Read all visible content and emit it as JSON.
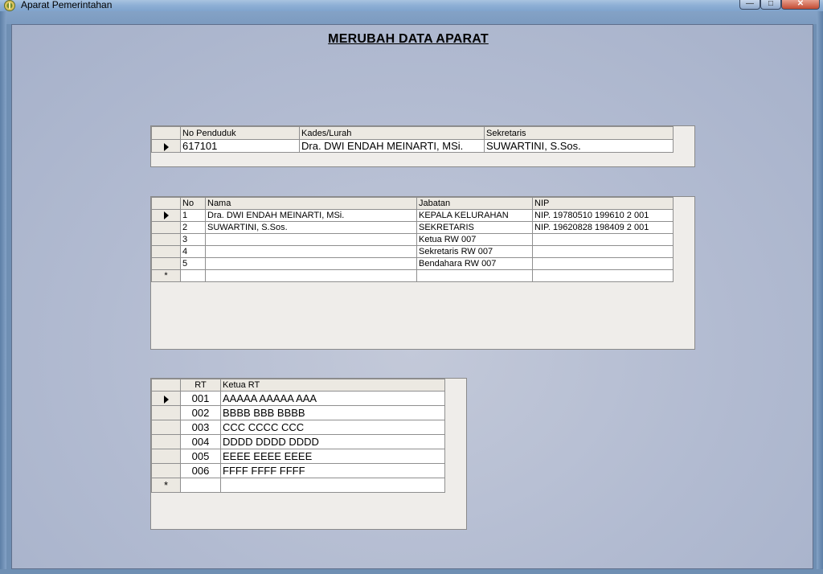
{
  "window": {
    "title": "Aparat Pemerintahan",
    "minimize_glyph": "—",
    "maximize_glyph": "□",
    "close_glyph": "✕"
  },
  "page": {
    "title": "MERUBAH DATA APARAT"
  },
  "grid_kelurahan": {
    "columns": [
      "No Penduduk",
      "Kades/Lurah",
      "Sekretaris"
    ],
    "rows": [
      [
        "617101",
        "Dra. DWI ENDAH MEINARTI, MSi.",
        "SUWARTINI, S.Sos."
      ]
    ]
  },
  "grid_aparat": {
    "columns": [
      "No",
      "Nama",
      "Jabatan",
      "NIP"
    ],
    "rows": [
      [
        "1",
        "Dra. DWI ENDAH MEINARTI, MSi.",
        "KEPALA KELURAHAN",
        "NIP. 19780510 199610 2 001"
      ],
      [
        "2",
        "SUWARTINI, S.Sos.",
        "SEKRETARIS",
        "NIP. 19620828 198409 2 001"
      ],
      [
        "3",
        "",
        "Ketua RW 007",
        ""
      ],
      [
        "4",
        "",
        "Sekretaris RW 007",
        ""
      ],
      [
        "5",
        "",
        "Bendahara RW 007",
        ""
      ]
    ]
  },
  "grid_rt": {
    "columns": [
      "RT",
      "Ketua RT"
    ],
    "rows": [
      [
        "001",
        "AAAAA AAAAA AAA"
      ],
      [
        "002",
        "BBBB BBB BBBB"
      ],
      [
        "003",
        "CCC CCCC CCC"
      ],
      [
        "004",
        "DDDD DDDD DDDD"
      ],
      [
        "005",
        "EEEE EEEE EEEE"
      ],
      [
        "006",
        "FFFF FFFF FFFF"
      ]
    ]
  },
  "row_indicators": {
    "current": "arrow-right-icon",
    "new": "*"
  }
}
